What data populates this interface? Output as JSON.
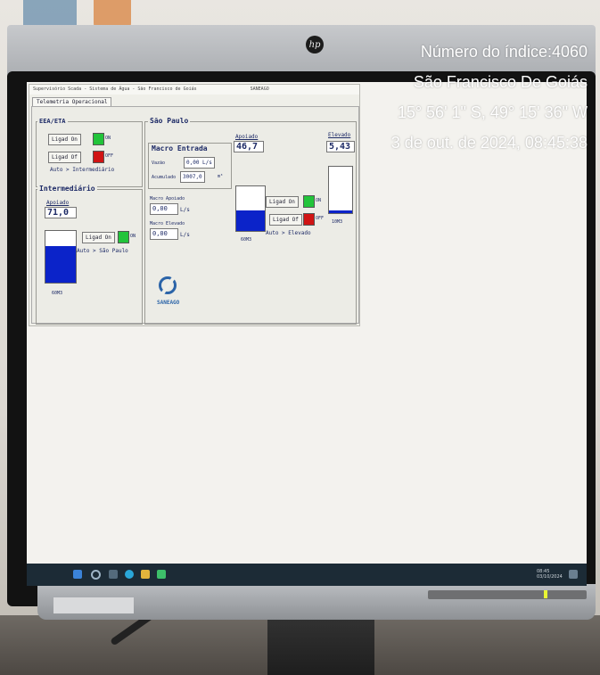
{
  "photo": {
    "overlay": {
      "index_line": "Número do índice:4060",
      "city_line": "São Francisco De Goiás",
      "coords_line": "15° 56' 1\" S, 49° 15' 36\" W",
      "datetime_line": "3 de out. de 2024, 08:45:38"
    },
    "monitor_brand": "hp"
  },
  "app": {
    "window_title": "Supervisório Scada - Sistema de Água - São Francisco de Goiás",
    "title_center": "SANEAGO",
    "tab_label": "Telemetria Operacional",
    "eea": {
      "title": "EEA/ETA",
      "ligado_label": "Ligad On",
      "ligado_state": "ON",
      "desligado_label": "Ligad Of",
      "desligado_state": "OFF",
      "auto_label": "Auto > Intermediário"
    },
    "intermediario": {
      "title": "Intermediário",
      "apoiado_label": "Apoiado",
      "level_value": "71,0",
      "level_percent": 71,
      "button_label": "Ligad On",
      "button_state": "ON",
      "auto_label": "Auto > São Paulo",
      "unit": "60M3"
    },
    "sao_paulo": {
      "title": "São Paulo",
      "macro_entrada_title": "Macro Entrada",
      "vazao_label": "Vazão",
      "vazao_value": "0,00 L/s",
      "acumulado_label": "Acumulado",
      "acumulado_value": "3007,0",
      "acumulado_unit": "m³",
      "macro_apoiado_label": "Macro Apoiado",
      "macro_apoiado_value": "0,00",
      "macro_apoiado_unit": "L/s",
      "macro_elevado_label": "Macro Elevado",
      "macro_elevado_value": "0,00",
      "macro_elevado_unit": "L/s",
      "apoiado_label": "Apoiado",
      "apoiado_value": "46,7",
      "apoiado_percent": 46.7,
      "apoiado_unit": "60M3",
      "elevado_label": "Elevado",
      "elevado_value": "5,43",
      "elevado_percent": 5.43,
      "elevado_unit": "10M3",
      "ligado_label": "Ligad On",
      "ligado_state": "ON",
      "desligado_label": "Ligad Of",
      "desligado_state": "OFF",
      "auto_label": "Auto > Elevado",
      "logo_label": "SANEAGO"
    }
  },
  "taskbar": {
    "tray_time": "08:45",
    "tray_date": "03/10/2024"
  },
  "colors": {
    "tank_fill": "#0b23c9",
    "on_indicator": "#22c43a",
    "off_indicator": "#d01414",
    "taskbar": "#1c2b36"
  }
}
